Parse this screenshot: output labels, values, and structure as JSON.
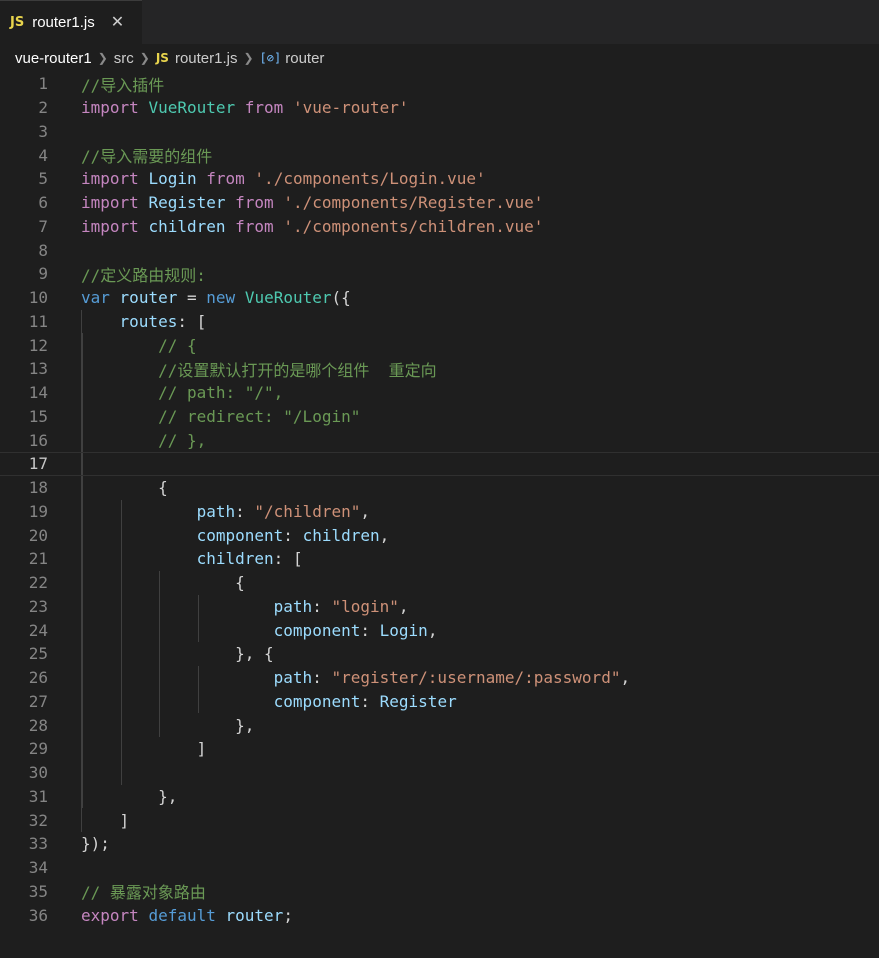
{
  "tab": {
    "title": "router1.js",
    "lang_badge": "JS"
  },
  "breadcrumb": {
    "project": "vue-router1",
    "folder": "src",
    "file": "router1.js",
    "symbol": "router"
  },
  "active_line": 17,
  "lines": [
    "//导入插件",
    "import VueRouter from 'vue-router'",
    "",
    "//导入需要的组件",
    "import Login from './components/Login.vue'",
    "import Register from './components/Register.vue'",
    "import children from './components/children.vue'",
    "",
    "//定义路由规则:",
    "var router = new VueRouter({",
    "    routes: [",
    "        // {",
    "        //设置默认打开的是哪个组件  重定向",
    "        // path: \"/\",",
    "        // redirect: \"/Login\"",
    "        // },",
    "",
    "        {",
    "            path: \"/children\",",
    "            component: children,",
    "            children: [",
    "                {",
    "                    path: \"login\",",
    "                    component: Login,",
    "                }, {",
    "                    path: \"register/:username/:password\",",
    "                    component: Register",
    "                },",
    "            ]",
    "",
    "        },",
    "    ]",
    "});",
    "",
    "// 暴露对象路由",
    "export default router;"
  ]
}
